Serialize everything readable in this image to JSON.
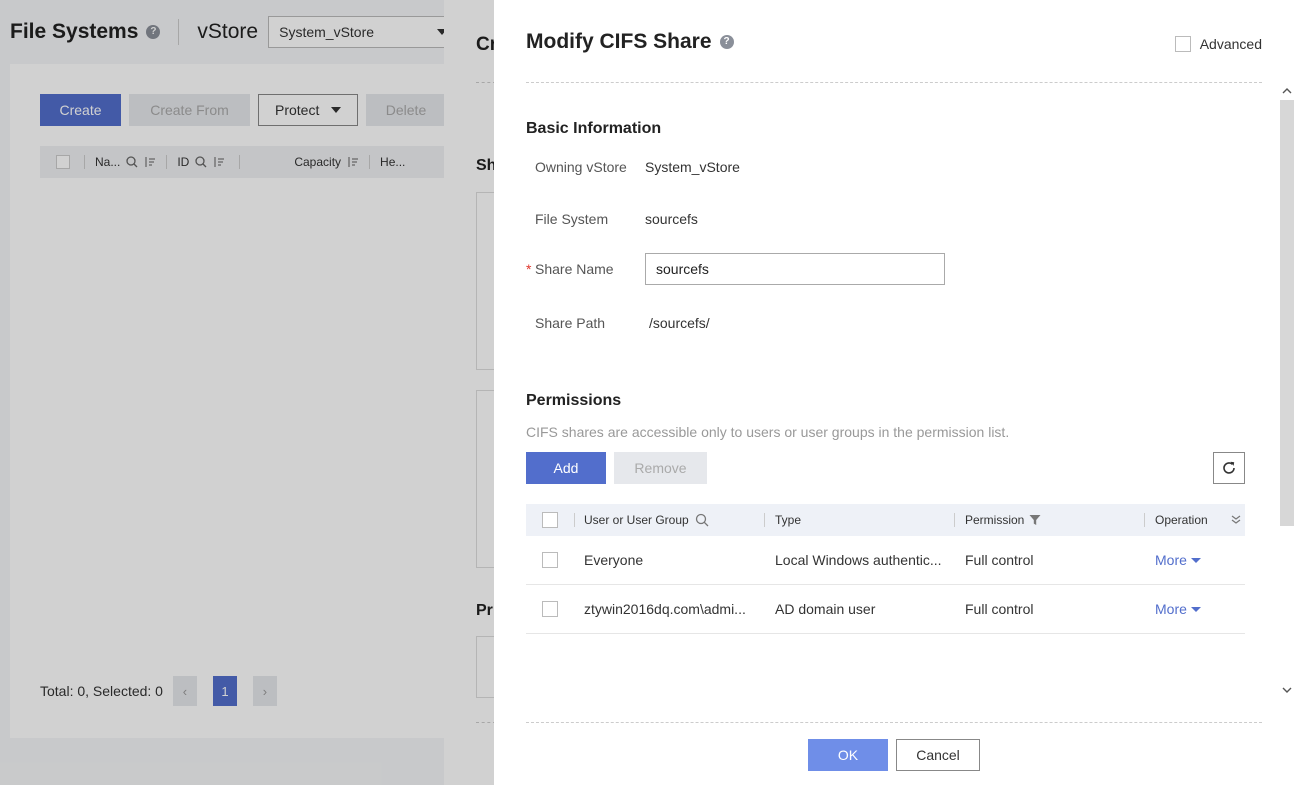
{
  "background": {
    "title": "File Systems",
    "vstore_label": "vStore",
    "vstore_value": "System_vStore",
    "toolbar": {
      "create": "Create",
      "create_from": "Create From",
      "protect": "Protect",
      "delete": "Delete"
    },
    "table_headers": {
      "name": "Na...",
      "id": "ID",
      "capacity": "Capacity",
      "health": "He..."
    },
    "footer": {
      "summary": "Total: 0, Selected: 0",
      "page": "1",
      "prev": "‹",
      "next": "›"
    },
    "mid_panel": {
      "title_fragment": "Cr",
      "section_fragment_1": "Sh",
      "section_fragment_2": "Pr"
    }
  },
  "drawer": {
    "title": "Modify CIFS Share",
    "advanced_label": "Advanced",
    "basic_info": {
      "title": "Basic Information",
      "owning_vstore_label": "Owning vStore",
      "owning_vstore_value": "System_vStore",
      "file_system_label": "File System",
      "file_system_value": "sourcefs",
      "share_name_label": "Share Name",
      "share_name_value": "sourcefs",
      "share_path_label": "Share Path",
      "share_path_value": "/sourcefs/"
    },
    "permissions": {
      "title": "Permissions",
      "hint": "CIFS shares are accessible only to users or user groups in the permission list.",
      "add": "Add",
      "remove": "Remove",
      "columns": {
        "user": "User or User Group",
        "type": "Type",
        "permission": "Permission",
        "operation": "Operation"
      },
      "rows": [
        {
          "user": "Everyone",
          "type": "Local Windows authentic...",
          "permission": "Full control",
          "operation": "More"
        },
        {
          "user": "ztywin2016dq.com\\admi...",
          "type": "AD domain user",
          "permission": "Full control",
          "operation": "More"
        }
      ]
    },
    "ok": "OK",
    "cancel": "Cancel"
  },
  "colors": {
    "primary": "#526ecc",
    "ok_button": "#6f8ee8",
    "required_star": "#e0362c"
  }
}
